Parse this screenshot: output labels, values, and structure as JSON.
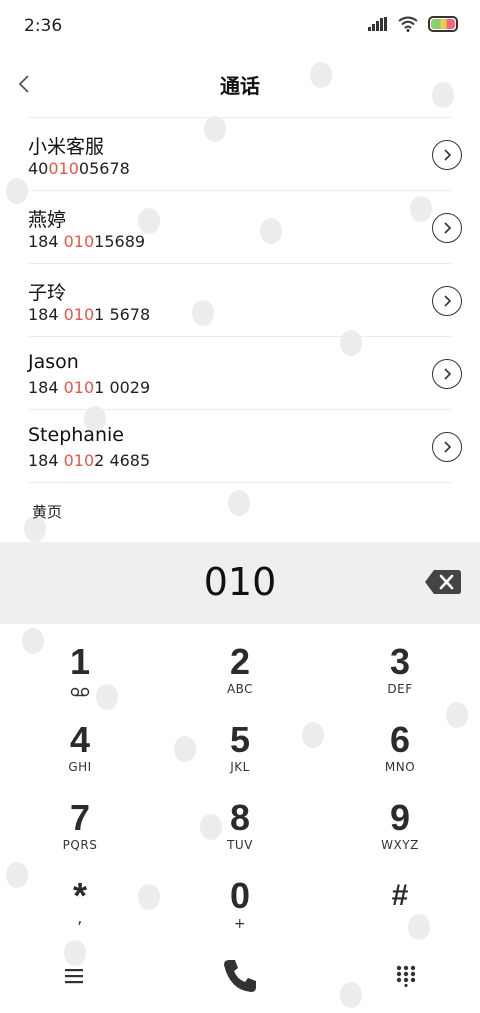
{
  "status": {
    "time": "2:36"
  },
  "header": {
    "title": "通话"
  },
  "contacts": [
    {
      "name": "小米客服",
      "num_pre": "40",
      "num_hl": "010",
      "num_post": "05678"
    },
    {
      "name": "燕婷",
      "num_pre": "184 ",
      "num_hl": "010",
      "num_post": "15689"
    },
    {
      "name": "子玲",
      "num_pre": "184 ",
      "num_hl": "010",
      "num_post": "1 5678"
    },
    {
      "name": "Jason",
      "num_pre": "184 ",
      "num_hl": "010",
      "num_post": "1 0029"
    },
    {
      "name": "Stephanie",
      "num_pre": "184 ",
      "num_hl": "010",
      "num_post": "2 4685"
    }
  ],
  "section": {
    "label": "黄页"
  },
  "dialer": {
    "input": "010"
  },
  "keys": [
    {
      "d": "1",
      "l": ""
    },
    {
      "d": "2",
      "l": "ABC"
    },
    {
      "d": "3",
      "l": "DEF"
    },
    {
      "d": "4",
      "l": "GHI"
    },
    {
      "d": "5",
      "l": "JKL"
    },
    {
      "d": "6",
      "l": "MNO"
    },
    {
      "d": "7",
      "l": "PQRS"
    },
    {
      "d": "8",
      "l": "TUV"
    },
    {
      "d": "9",
      "l": "WXYZ"
    },
    {
      "d": "*",
      "l": ","
    },
    {
      "d": "0",
      "l": "+"
    },
    {
      "d": "#",
      "l": ""
    }
  ],
  "colors": {
    "highlight": "#e8564a",
    "input_bg": "#efefef"
  },
  "icons": {
    "back": "chevron-left-icon",
    "detail": "chevron-right-circle-icon",
    "backspace": "backspace-icon",
    "voicemail": "voicemail-icon",
    "menu": "menu-icon",
    "call": "phone-icon",
    "keypad": "keypad-grid-icon"
  }
}
